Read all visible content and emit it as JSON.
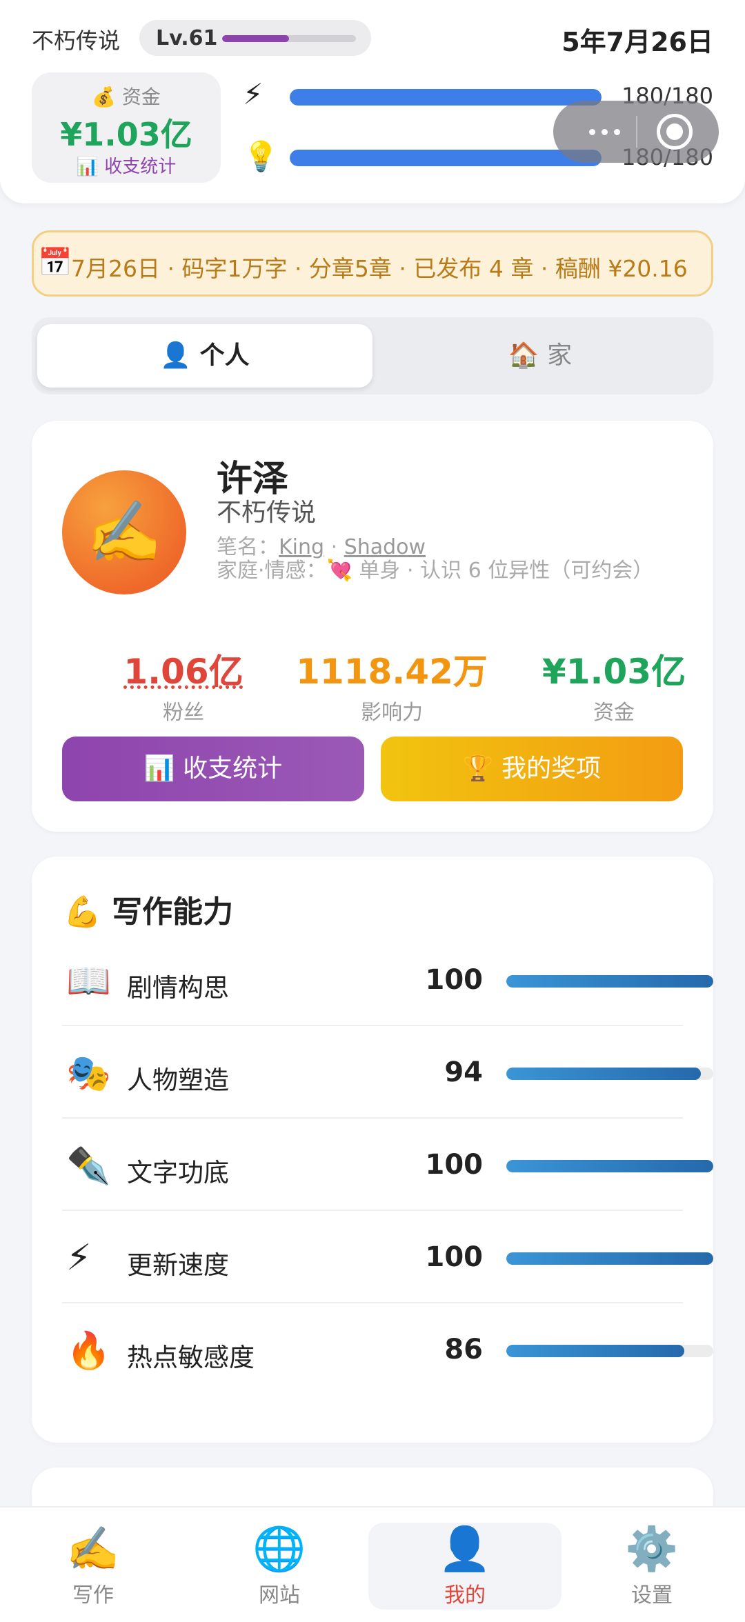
{
  "header": {
    "game_title": "不朽传说",
    "level": "Lv.61",
    "level_progress": 0.5,
    "date": "5年7月26日",
    "funds_label": "💰 资金",
    "funds_value": "¥1.03亿",
    "funds_link": "📊 收支统计",
    "energy_icon": "⚡",
    "energy_text": "180/180",
    "energy_progress": 1.0,
    "inspiration_icon": "💡",
    "inspiration_text": "180/180",
    "inspiration_progress": 1.0
  },
  "banner": {
    "icon": "📅",
    "text": "7月26日 · 码字1万字 · 分章5章 · 已发布 4 章 · 稿酬 ¥20.16"
  },
  "tabs": [
    {
      "label": "👤 个人",
      "active": true
    },
    {
      "label": "🏠 家",
      "active": false
    }
  ],
  "profile": {
    "avatar_emoji": "✍️",
    "name": "许泽",
    "title": "不朽传说",
    "pen_label": "笔名：",
    "pen_names": [
      "King",
      "Shadow"
    ],
    "pen_sep": " · ",
    "family": "家庭·情感：💘 单身 · 认识 6 位异性（可约会）",
    "metrics": [
      {
        "value": "1.06亿",
        "label": "粉丝"
      },
      {
        "value": "1118.42万",
        "label": "影响力"
      },
      {
        "value": "¥1.03亿",
        "label": "资金"
      }
    ],
    "buttons": {
      "stats": "📊 收支统计",
      "awards": "🏆 我的奖项"
    }
  },
  "abilities": {
    "title": "💪 写作能力",
    "items": [
      {
        "icon": "📖",
        "label": "剧情构思",
        "value": "100",
        "level": 1.0
      },
      {
        "icon": "🎭",
        "label": "人物塑造",
        "value": "94",
        "level": 0.94
      },
      {
        "icon": "✒️",
        "label": "文字功底",
        "value": "100",
        "level": 1.0
      },
      {
        "icon": "⚡",
        "label": "更新速度",
        "value": "100",
        "level": 1.0
      },
      {
        "icon": "🔥",
        "label": "热点敏感度",
        "value": "86",
        "level": 0.86
      }
    ]
  },
  "nav": [
    {
      "icon": "✍️",
      "label": "写作",
      "active": false
    },
    {
      "icon": "🌐",
      "label": "网站",
      "active": false
    },
    {
      "icon": "👤",
      "label": "我的",
      "active": true
    },
    {
      "icon": "⚙️",
      "label": "设置",
      "active": false
    }
  ],
  "colors": {
    "accent_purple": "#8e44ad",
    "accent_gold": "#f39c12",
    "money_green": "#1fa45b",
    "fans_red": "#e0453a",
    "energy_blue": "#3d7ee9",
    "ability_blue": "#2a7fc4"
  }
}
